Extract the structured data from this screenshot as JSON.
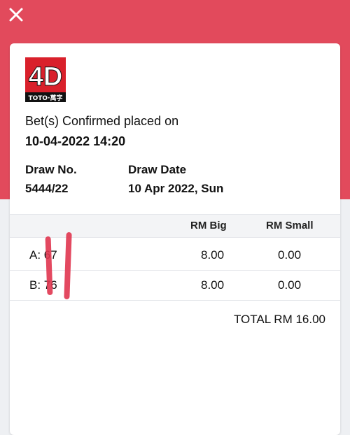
{
  "header": {
    "close_icon": "close-icon"
  },
  "logo": {
    "text": "4D",
    "caption": "TOTO·萬字"
  },
  "confirmation": {
    "label": "Bet(s) Confirmed placed on",
    "datetime": "10-04-2022 14:20"
  },
  "draw": {
    "number_label": "Draw No.",
    "number_value": "5444/22",
    "date_label": "Draw Date",
    "date_value": "10 Apr 2022, Sun"
  },
  "table": {
    "headers": {
      "big": "RM Big",
      "small": "RM Small"
    },
    "rows": [
      {
        "number": "A: 67",
        "big": "8.00",
        "small": "0.00"
      },
      {
        "number": "B: 76",
        "big": "8.00",
        "small": "0.00"
      }
    ]
  },
  "total": "TOTAL RM 16.00",
  "colors": {
    "accent": "#e24a5c",
    "logo_red": "#d9202b"
  }
}
